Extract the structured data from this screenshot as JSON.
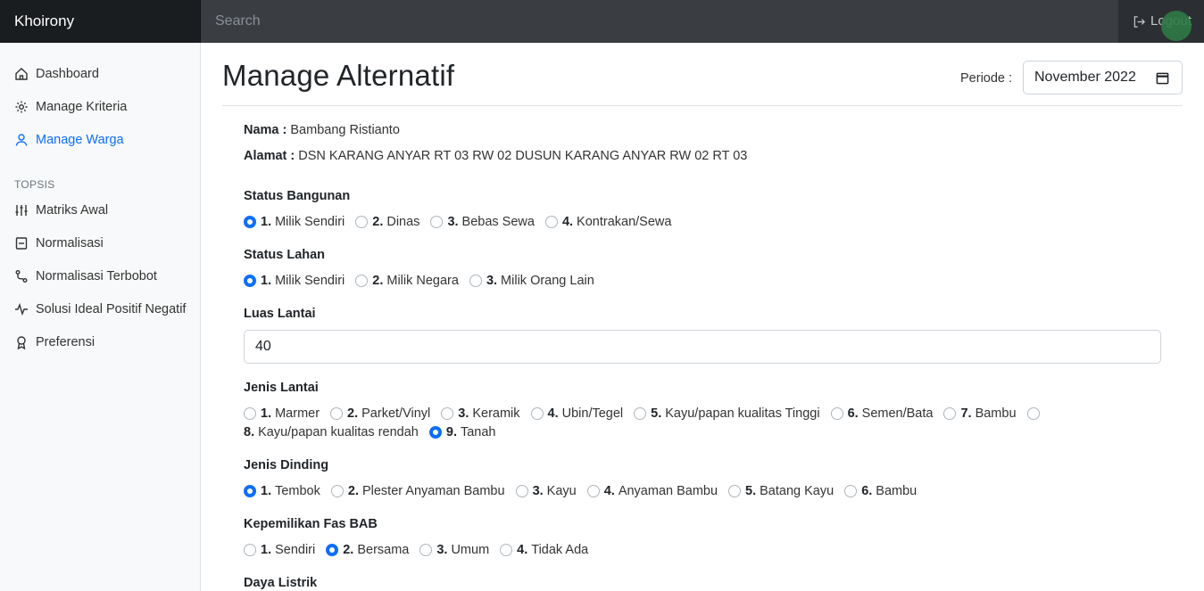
{
  "navbar": {
    "brand": "Khoirony",
    "search_placeholder": "Search",
    "logout_label": "Logout"
  },
  "sidebar": {
    "items": [
      {
        "label": "Dashboard",
        "icon": "house-icon"
      },
      {
        "label": "Manage Kriteria",
        "icon": "gear-icon"
      },
      {
        "label": "Manage Warga",
        "icon": "person-icon",
        "active": true
      }
    ],
    "section_heading": "TOPSIS",
    "topsis_items": [
      {
        "label": "Matriks Awal",
        "icon": "sliders-icon"
      },
      {
        "label": "Normalisasi",
        "icon": "file-icon"
      },
      {
        "label": "Normalisasi Terbobot",
        "icon": "route-icon"
      },
      {
        "label": "Solusi Ideal Positif Negatif",
        "icon": "activity-icon"
      },
      {
        "label": "Preferensi",
        "icon": "award-icon"
      }
    ]
  },
  "page": {
    "title": "Manage Alternatif",
    "periode_label": "Periode :",
    "periode_value": "November 2022"
  },
  "person": {
    "nama_label": "Nama :",
    "nama": "Bambang Ristianto",
    "alamat_label": "Alamat :",
    "alamat": "DSN KARANG ANYAR RT 03 RW 02 DUSUN KARANG ANYAR RW 02 RT 03"
  },
  "form": {
    "status_bangunan": {
      "label": "Status Bangunan",
      "options": [
        {
          "num": "1.",
          "text": "Milik Sendiri",
          "checked": true
        },
        {
          "num": "2.",
          "text": "Dinas"
        },
        {
          "num": "3.",
          "text": "Bebas Sewa"
        },
        {
          "num": "4.",
          "text": "Kontrakan/Sewa"
        }
      ]
    },
    "status_lahan": {
      "label": "Status Lahan",
      "options": [
        {
          "num": "1.",
          "text": "Milik Sendiri",
          "checked": true
        },
        {
          "num": "2.",
          "text": "Milik Negara"
        },
        {
          "num": "3.",
          "text": "Milik Orang Lain"
        }
      ]
    },
    "luas_lantai": {
      "label": "Luas Lantai",
      "value": "40"
    },
    "jenis_lantai": {
      "label": "Jenis Lantai",
      "options": [
        {
          "num": "1.",
          "text": "Marmer"
        },
        {
          "num": "2.",
          "text": "Parket/Vinyl"
        },
        {
          "num": "3.",
          "text": "Keramik"
        },
        {
          "num": "4.",
          "text": "Ubin/Tegel"
        },
        {
          "num": "5.",
          "text": "Kayu/papan kualitas Tinggi"
        },
        {
          "num": "6.",
          "text": "Semen/Bata"
        },
        {
          "num": "7.",
          "text": "Bambu"
        },
        {
          "num": "8.",
          "text": "Kayu/papan kualitas rendah"
        },
        {
          "num": "9.",
          "text": "Tanah",
          "checked": true
        }
      ]
    },
    "jenis_dinding": {
      "label": "Jenis Dinding",
      "options": [
        {
          "num": "1.",
          "text": "Tembok",
          "checked": true
        },
        {
          "num": "2.",
          "text": "Plester Anyaman Bambu"
        },
        {
          "num": "3.",
          "text": "Kayu"
        },
        {
          "num": "4.",
          "text": "Anyaman Bambu"
        },
        {
          "num": "5.",
          "text": "Batang Kayu"
        },
        {
          "num": "6.",
          "text": "Bambu"
        }
      ]
    },
    "kepemilikan_fas_bab": {
      "label": "Kepemilikan Fas BAB",
      "options": [
        {
          "num": "1.",
          "text": "Sendiri"
        },
        {
          "num": "2.",
          "text": "Bersama",
          "checked": true
        },
        {
          "num": "3.",
          "text": "Umum"
        },
        {
          "num": "4.",
          "text": "Tidak Ada"
        }
      ]
    },
    "daya_listrik": {
      "label": "Daya Listrik"
    }
  }
}
